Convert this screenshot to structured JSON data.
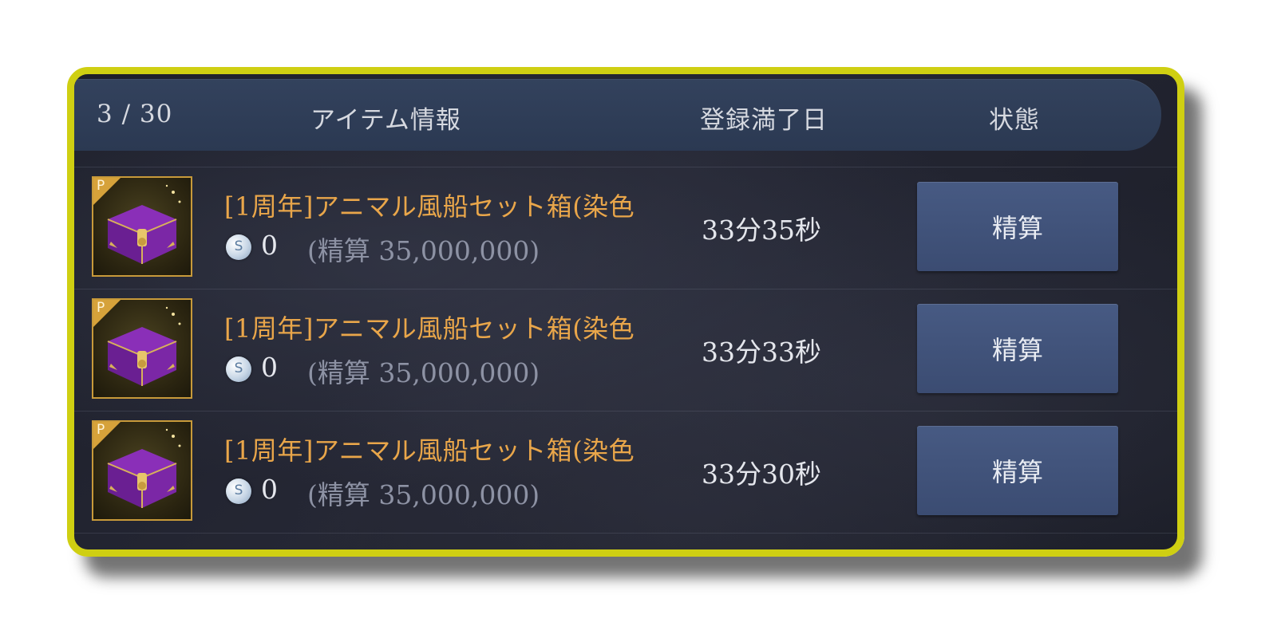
{
  "header": {
    "count": "3 / 30",
    "item_info": "アイテム情報",
    "expiry_date": "登録満了日",
    "status": "状態"
  },
  "rows": [
    {
      "badge": "P",
      "icon": "purple-treasure-chest-icon",
      "name": "[1周年]アニマル風船セット箱(染色",
      "price": "0",
      "settlement": "(精算 35,000,000)",
      "time_left": "33分35秒",
      "action": "精算"
    },
    {
      "badge": "P",
      "icon": "purple-treasure-chest-icon",
      "name": "[1周年]アニマル風船セット箱(染色",
      "price": "0",
      "settlement": "(精算 35,000,000)",
      "time_left": "33分33秒",
      "action": "精算"
    },
    {
      "badge": "P",
      "icon": "purple-treasure-chest-icon",
      "name": "[1周年]アニマル風船セット箱(染色",
      "price": "0",
      "settlement": "(精算 35,000,000)",
      "time_left": "33分30秒",
      "action": "精算"
    }
  ],
  "coin_symbol": "S",
  "colors": {
    "highlight_border": "#cfcf12",
    "item_name": "#e9a64a",
    "button": "#3f5078",
    "header": "#2f3e58"
  }
}
